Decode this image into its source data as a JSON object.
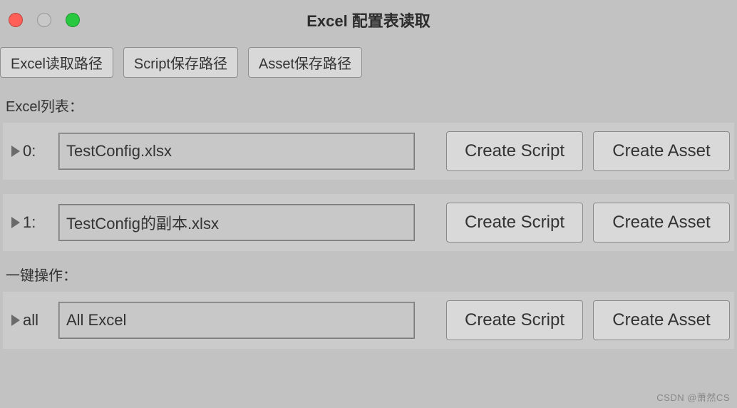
{
  "window": {
    "title": "Excel 配置表读取"
  },
  "toolbar": {
    "excel_path_label": "Excel读取路径",
    "script_path_label": "Script保存路径",
    "asset_path_label": "Asset保存路径"
  },
  "list_section": {
    "label": "Excel列表：",
    "rows": [
      {
        "index_label": "0:",
        "filename": "TestConfig.xlsx",
        "create_script_label": "Create Script",
        "create_asset_label": "Create Asset"
      },
      {
        "index_label": "1:",
        "filename": "TestConfig的副本.xlsx",
        "create_script_label": "Create Script",
        "create_asset_label": "Create Asset"
      }
    ]
  },
  "batch_section": {
    "label": "一键操作：",
    "row": {
      "index_label": "all",
      "filename": "All Excel",
      "create_script_label": "Create Script",
      "create_asset_label": "Create Asset"
    }
  },
  "watermark": "CSDN @萧然CS"
}
